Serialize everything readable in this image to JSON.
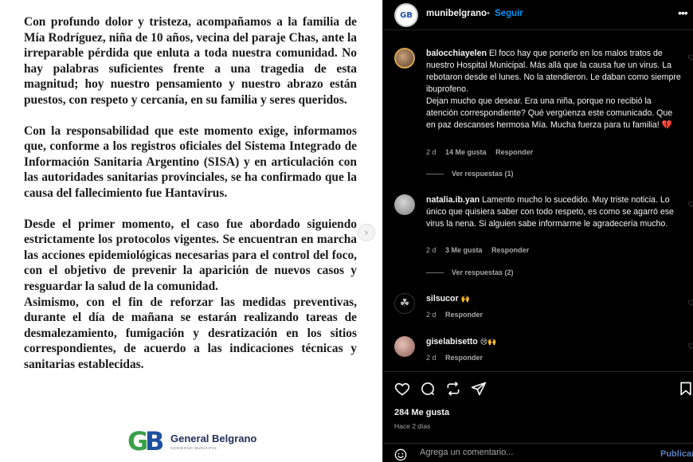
{
  "post_image": {
    "paragraphs": [
      "Con profundo dolor y tristeza, acompañamos a la familia de Mía Rodríguez, niña de 10 años, vecina del paraje Chas, ante la irreparable pérdida que enluta a toda nuestra comunidad. No hay palabras suficientes frente a una tragedia de esta magnitud; hoy nuestro pensamiento y nuestro abrazo están puestos, con respeto y cercanía, en su familia y seres queridos.",
      "Con la responsabilidad que este momento exige, informamos que, conforme a los registros oficiales del Sistema Integrado de Información Sanitaria Argentino (SISA) y en articulación con las autoridades sanitarias provinciales, se ha confirmado que la causa del fallecimiento fue Hantavirus.",
      "Desde el primer momento, el caso fue abordado siguiendo estrictamente los protocolos vigentes. Se encuentran en marcha las acciones epidemiológicas necesarias para el control del foco, con el objetivo de prevenir la aparición de nuevos casos y resguardar la salud de la comunidad.",
      "Asimismo, con el fin de reforzar las medidas preventivas, durante el día de mañana se estarán realizando tareas de desmalezamiento, fumigación y desratización en los sitios correspondientes, de acuerdo a las indicaciones técnicas y sanitarias establecidas."
    ],
    "logo": {
      "mark": "GB",
      "title": "General Belgrano",
      "subtitle": "GOBIERNO MUNICIPAL"
    }
  },
  "header": {
    "avatar_text": "GB",
    "username": "munibelgrano",
    "separator": "•",
    "follow_label": "Seguir",
    "more": "•••"
  },
  "comments": [
    {
      "username": "balocchiayelen",
      "text": "El foco hay que ponerlo en los malos tratos de nuestro Hospital Municipal. Más allá que la causa fue un virus. La rebotaron desde el lunes. No la atendieron. Le daban como siempre ibuprofeno.\nDejan mucho que desear. Era una niña, porque no recibió la atención correspondiente? Qué vergüenza este comunicado. Que en paz descanses hermosa Mía. Mucha fuerza para tu familia! 💔",
      "age": "2 d",
      "likes": "14 Me gusta",
      "reply": "Responder",
      "view_replies": "Ver respuestas (1)"
    },
    {
      "username": "natalia.ib.yan",
      "text": "Lamento mucho lo sucedido. Muy triste noticia. Lo único que quisiera saber con todo respeto, es como se agarró ese virus la nena. Si alguien sabe informarme le agradecería mucho.",
      "age": "2 d",
      "likes": "3 Me gusta",
      "reply": "Responder",
      "view_replies": "Ver respuestas (2)"
    },
    {
      "username": "silsucor",
      "text": "🙌",
      "age": "2 d",
      "reply": "Responder"
    },
    {
      "username": "giselabisetto",
      "text": "😢🙌",
      "age": "2 d",
      "reply": "Responder"
    }
  ],
  "actions": {
    "like_icon": "heart-icon",
    "comment_icon": "comment-icon",
    "share_icon": "repost-icon",
    "send_icon": "send-icon",
    "save_icon": "bookmark-icon"
  },
  "likes_count": "284 Me gusta",
  "time_ago": "Hace 2 días",
  "comment_box": {
    "placeholder": "Agrega un comentario...",
    "publish_label": "Publicar"
  },
  "colors": {
    "follow": "#0095f6",
    "background": "#000000",
    "muted": "#a8a8a8",
    "broken_heart": "#e0245e"
  }
}
